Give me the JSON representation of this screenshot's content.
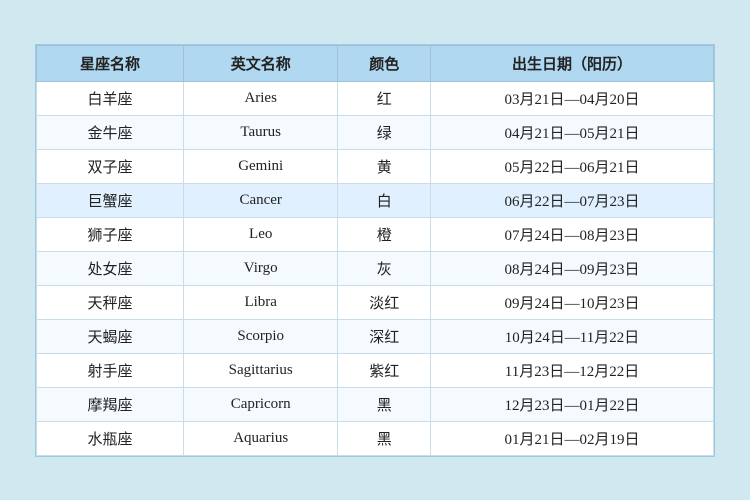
{
  "table": {
    "headers": [
      "星座名称",
      "英文名称",
      "颜色",
      "出生日期（阳历）"
    ],
    "rows": [
      {
        "chinese": "白羊座",
        "english": "Aries",
        "color": "红",
        "dates": "03月21日—04月20日",
        "highlight": false
      },
      {
        "chinese": "金牛座",
        "english": "Taurus",
        "color": "绿",
        "dates": "04月21日—05月21日",
        "highlight": false
      },
      {
        "chinese": "双子座",
        "english": "Gemini",
        "color": "黄",
        "dates": "05月22日—06月21日",
        "highlight": false
      },
      {
        "chinese": "巨蟹座",
        "english": "Cancer",
        "color": "白",
        "dates": "06月22日—07月23日",
        "highlight": true
      },
      {
        "chinese": "狮子座",
        "english": "Leo",
        "color": "橙",
        "dates": "07月24日—08月23日",
        "highlight": false
      },
      {
        "chinese": "处女座",
        "english": "Virgo",
        "color": "灰",
        "dates": "08月24日—09月23日",
        "highlight": false
      },
      {
        "chinese": "天秤座",
        "english": "Libra",
        "color": "淡红",
        "dates": "09月24日—10月23日",
        "highlight": false
      },
      {
        "chinese": "天蝎座",
        "english": "Scorpio",
        "color": "深红",
        "dates": "10月24日—11月22日",
        "highlight": false
      },
      {
        "chinese": "射手座",
        "english": "Sagittarius",
        "color": "紫红",
        "dates": "11月23日—12月22日",
        "highlight": false
      },
      {
        "chinese": "摩羯座",
        "english": "Capricorn",
        "color": "黑",
        "dates": "12月23日—01月22日",
        "highlight": false
      },
      {
        "chinese": "水瓶座",
        "english": "Aquarius",
        "color": "黑",
        "dates": "01月21日—02月19日",
        "highlight": false
      }
    ]
  }
}
